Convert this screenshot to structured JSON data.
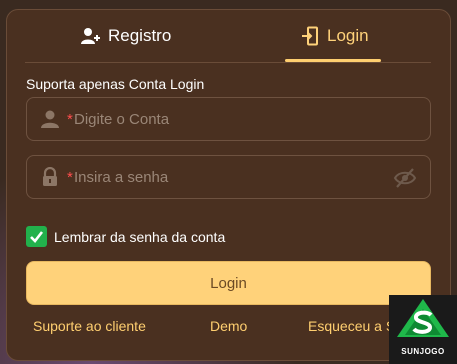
{
  "tabs": {
    "register_label": "Registro",
    "login_label": "Login"
  },
  "form": {
    "hint": "Suporta apenas Conta Login",
    "account": {
      "required_mark": "*",
      "placeholder": "Digite o Conta"
    },
    "password": {
      "required_mark": "*",
      "placeholder": "Insira a senha"
    },
    "remember_label": "Lembrar da senha da conta",
    "remember_checked": true,
    "submit_label": "Login"
  },
  "links": {
    "support": "Suporte ao cliente",
    "demo": "Demo",
    "forgot": "Esqueceu a S"
  },
  "brand": {
    "name": "SUNJOGO"
  },
  "icons": [
    "user-plus-icon",
    "login-door-icon",
    "user-icon",
    "lock-icon",
    "eye-off-icon",
    "checkmark-icon",
    "sunjogo-logo"
  ],
  "colors": {
    "accent": "#ffd27a",
    "panel": "#4a3020",
    "check": "#22b14c",
    "required": "#ff4d4d"
  }
}
